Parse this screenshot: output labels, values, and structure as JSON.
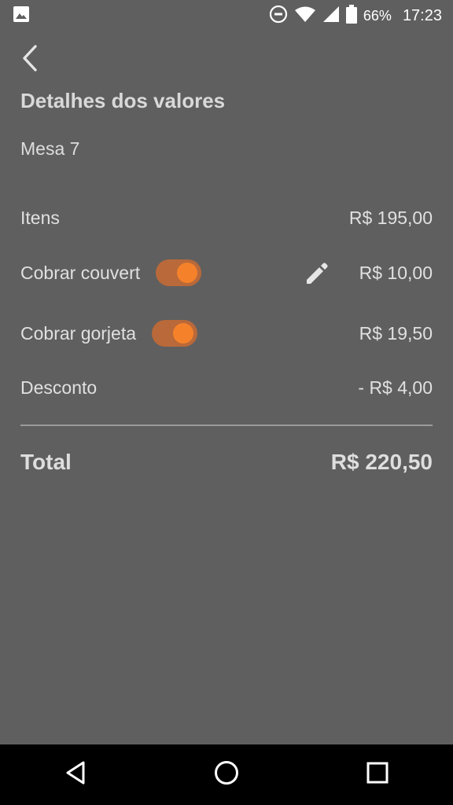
{
  "status_bar": {
    "battery": "66%",
    "time": "17:23",
    "icons": [
      "image-icon",
      "do-not-disturb-icon",
      "wifi-icon",
      "signal-icon",
      "battery-icon"
    ]
  },
  "header": {
    "back_icon": "back-arrow-icon",
    "title": "Detalhes dos valores",
    "subtitle": "Mesa 7"
  },
  "rows": [
    {
      "label": "Itens",
      "value": "R$ 195,00"
    },
    {
      "label": "Cobrar couvert",
      "value": "R$ 10,00",
      "toggle_on": true,
      "editable": true
    },
    {
      "label": "Cobrar gorjeta",
      "value": "R$ 19,50",
      "toggle_on": true
    },
    {
      "label": "Desconto",
      "value": "- R$ 4,00"
    }
  ],
  "total": {
    "label": "Total",
    "value": "R$ 220,50"
  },
  "colors": {
    "background": "#5f5f5f",
    "accent": "#f5822a",
    "toggle_track": "#b9693a"
  },
  "nav_bar": {
    "icons": [
      "back-triangle-icon",
      "home-circle-icon",
      "recents-square-icon"
    ]
  }
}
